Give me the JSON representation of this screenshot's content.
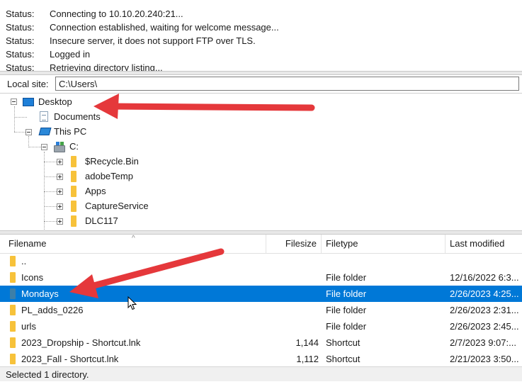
{
  "log": [
    {
      "label": "Status:",
      "text": "Connecting to 10.10.20.240:21..."
    },
    {
      "label": "Status:",
      "text": "Connection established, waiting for welcome message..."
    },
    {
      "label": "Status:",
      "text": "Insecure server, it does not support FTP over TLS."
    },
    {
      "label": "Status:",
      "text": "Logged in"
    },
    {
      "label": "Status:",
      "text": "Retrieving directory listing..."
    }
  ],
  "local_site": {
    "label": "Local site:",
    "value": "C:\\Users\\"
  },
  "tree": {
    "desktop": "Desktop",
    "documents": "Documents",
    "this_pc": "This PC",
    "drive_c": "C:",
    "folders": [
      "$Recycle.Bin",
      "adobeTemp",
      "Apps",
      "CaptureService",
      "DLC117"
    ]
  },
  "file_list": {
    "headers": {
      "filename": "Filename",
      "filesize": "Filesize",
      "filetype": "Filetype",
      "last_modified": "Last modified"
    },
    "rows": [
      {
        "name": "..",
        "size": "",
        "type": "",
        "modified": ""
      },
      {
        "name": "Icons",
        "size": "",
        "type": "File folder",
        "modified": "12/16/2022 6:3..."
      },
      {
        "name": "Mondays",
        "size": "",
        "type": "File folder",
        "modified": "2/26/2023 4:25..."
      },
      {
        "name": "PL_adds_0226",
        "size": "",
        "type": "File folder",
        "modified": "2/26/2023 2:31..."
      },
      {
        "name": "urls",
        "size": "",
        "type": "File folder",
        "modified": "2/26/2023 2:45..."
      },
      {
        "name": "2023_Dropship - Shortcut.lnk",
        "size": "1,144",
        "type": "Shortcut",
        "modified": "2/7/2023 9:07:..."
      },
      {
        "name": "2023_Fall - Shortcut.lnk",
        "size": "1,112",
        "type": "Shortcut",
        "modified": "2/21/2023 3:50..."
      }
    ],
    "selected_index": 2
  },
  "status_bar": "Selected 1 directory.",
  "colors": {
    "selection": "#0078d7",
    "folder": "#f7c23a",
    "arrow": "#e5383b"
  }
}
